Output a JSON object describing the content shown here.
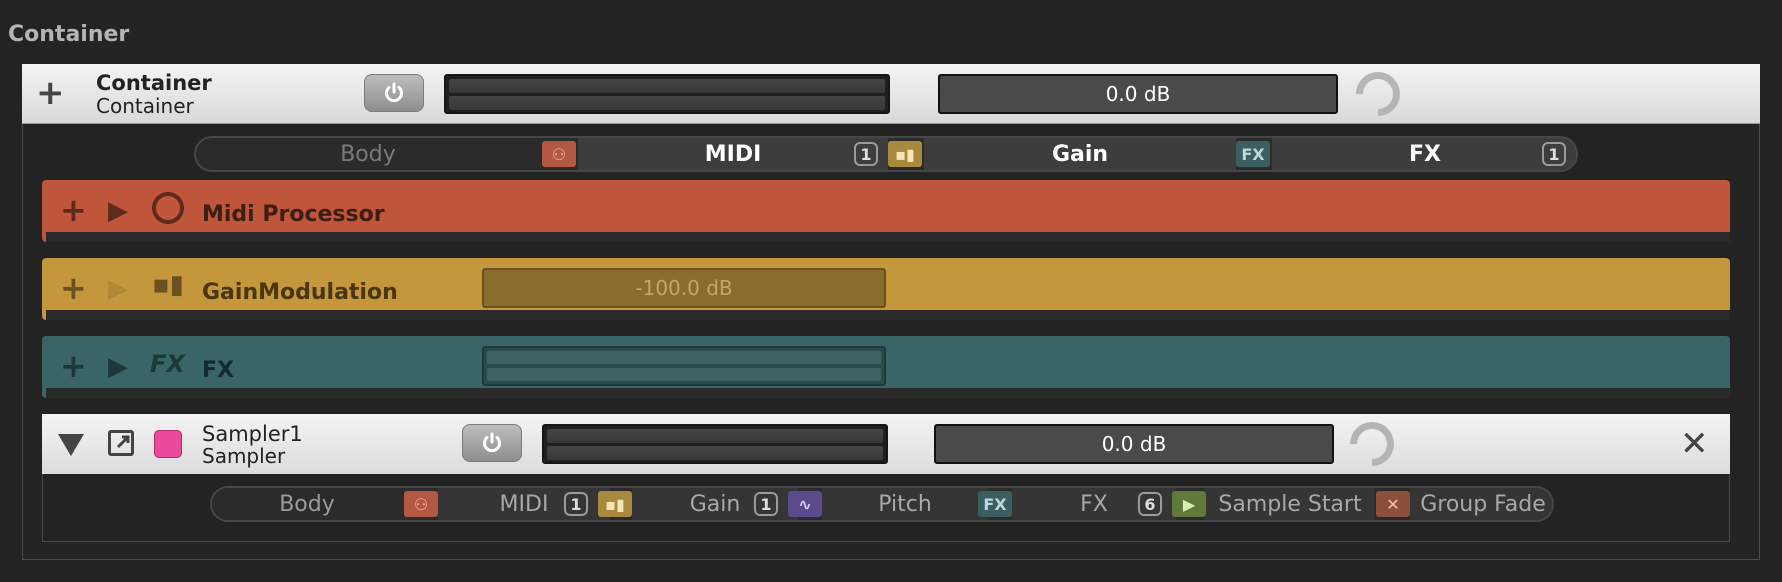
{
  "section": {
    "title": "Container"
  },
  "container": {
    "name": "Container",
    "type": "Container",
    "gain_value": "0.0 dB",
    "tabs": {
      "body": "Body",
      "midi": "MIDI",
      "midi_count": "1",
      "gain": "Gain",
      "fx": "FX",
      "fx_count": "1"
    }
  },
  "processors": {
    "midi": {
      "label": "Midi Processor",
      "color": "#bf553a"
    },
    "gainmod": {
      "label": "GainModulation",
      "value": "-100.0 dB",
      "color": "#c4973d"
    },
    "fx": {
      "label": "FX",
      "color": "#3a6566"
    }
  },
  "sampler": {
    "name": "Sampler1",
    "type": "Sampler",
    "color": "#ea4a9c",
    "gain_value": "0.0 dB",
    "tabs": {
      "body": "Body",
      "midi": "MIDI",
      "midi_count": "1",
      "gain": "Gain",
      "gain_count": "1",
      "pitch": "Pitch",
      "fx": "FX",
      "fx_count": "6",
      "sample_start": "Sample Start",
      "group_fade": "Group Fade"
    }
  },
  "icons": {
    "fx_chip": "FX"
  }
}
